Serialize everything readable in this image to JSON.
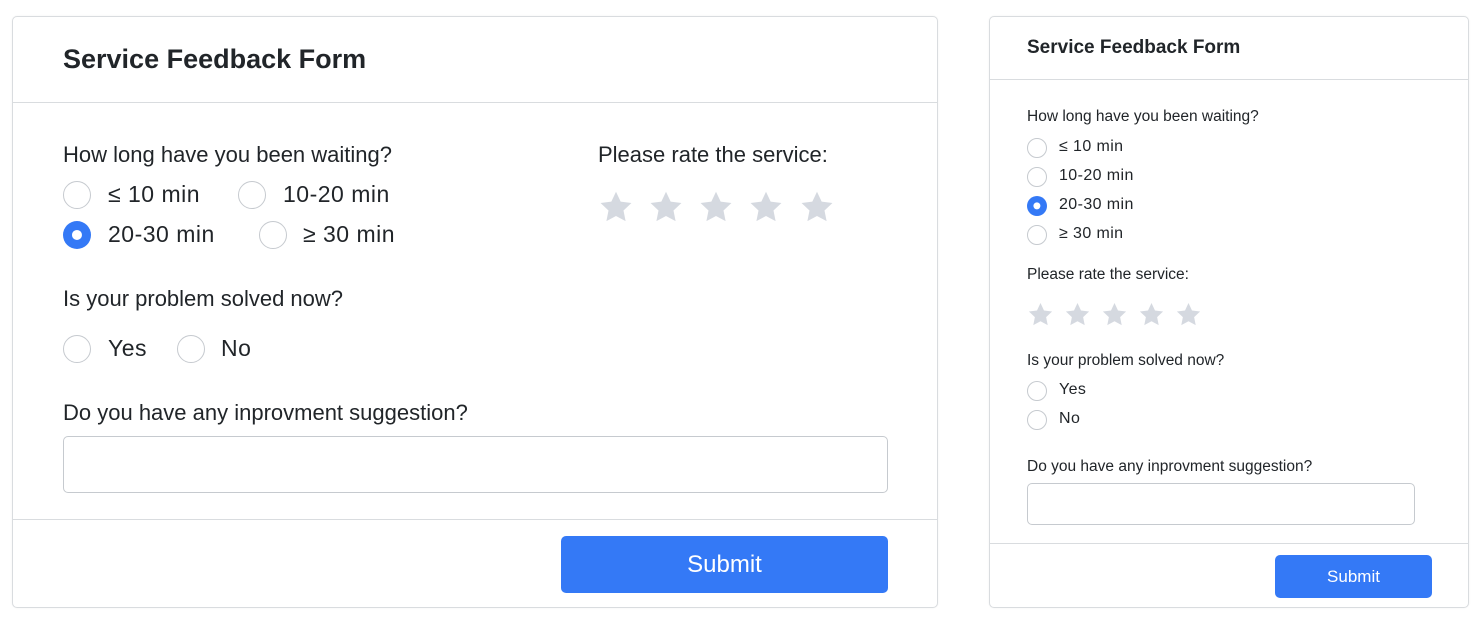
{
  "form": {
    "title": "Service Feedback Form",
    "wait_question": "How long have you been waiting?",
    "wait_options": [
      "≤ 10 min",
      "10-20 min",
      "20-30 min",
      "≥ 30 min"
    ],
    "wait_selected": "20-30 min",
    "rating_label": "Please rate the service:",
    "rating_stars_total": 5,
    "rating_value": 0,
    "solved_question": "Is your problem solved now?",
    "solved_options": [
      "Yes",
      "No"
    ],
    "solved_selected": null,
    "suggestion_question": "Do you have any inprovment suggestion?",
    "suggestion_value": "",
    "submit_label": "Submit"
  },
  "colors": {
    "accent": "#3479f6",
    "star_inactive": "#d5d9e0",
    "border": "#d9dcdf",
    "text": "#212529"
  },
  "icons": {
    "star": "star-icon"
  }
}
